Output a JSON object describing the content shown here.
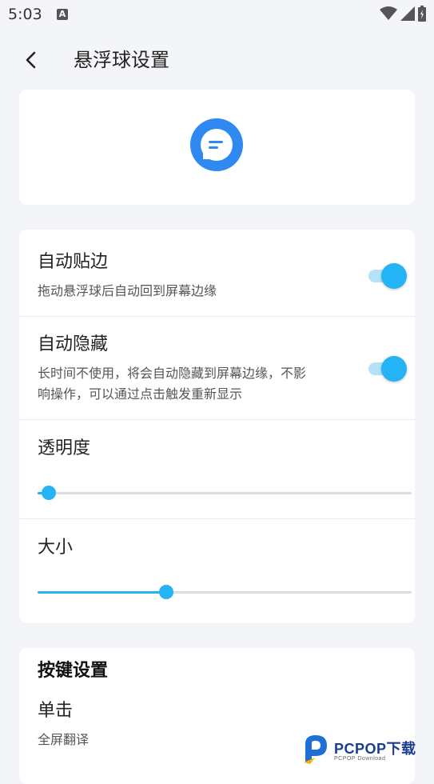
{
  "status_bar": {
    "time": "5:03",
    "notification_icon": "A"
  },
  "header": {
    "title": "悬浮球设置"
  },
  "settings": {
    "auto_snap": {
      "title": "自动贴边",
      "description": "拖动悬浮球后自动回到屏幕边缘",
      "enabled": true
    },
    "auto_hide": {
      "title": "自动隐藏",
      "description_line1": "长时间不使用，将会自动隐藏到屏幕边缘，不影",
      "description_line2": "响操作，可以通过点击触发重新显示",
      "enabled": true
    },
    "opacity": {
      "title": "透明度",
      "value_fraction": 0.03
    },
    "size": {
      "title": "大小",
      "value_fraction": 0.344
    }
  },
  "key_settings": {
    "section_title": "按键设置",
    "single_tap": {
      "title": "单击",
      "value": "全屏翻译"
    }
  },
  "watermark": {
    "brand": "PCPOP下载",
    "sub": "PCPOP Download"
  },
  "colors": {
    "accent": "#24b3f4",
    "ball_blue": "#2f89f1",
    "background": "#f3f5f9"
  }
}
